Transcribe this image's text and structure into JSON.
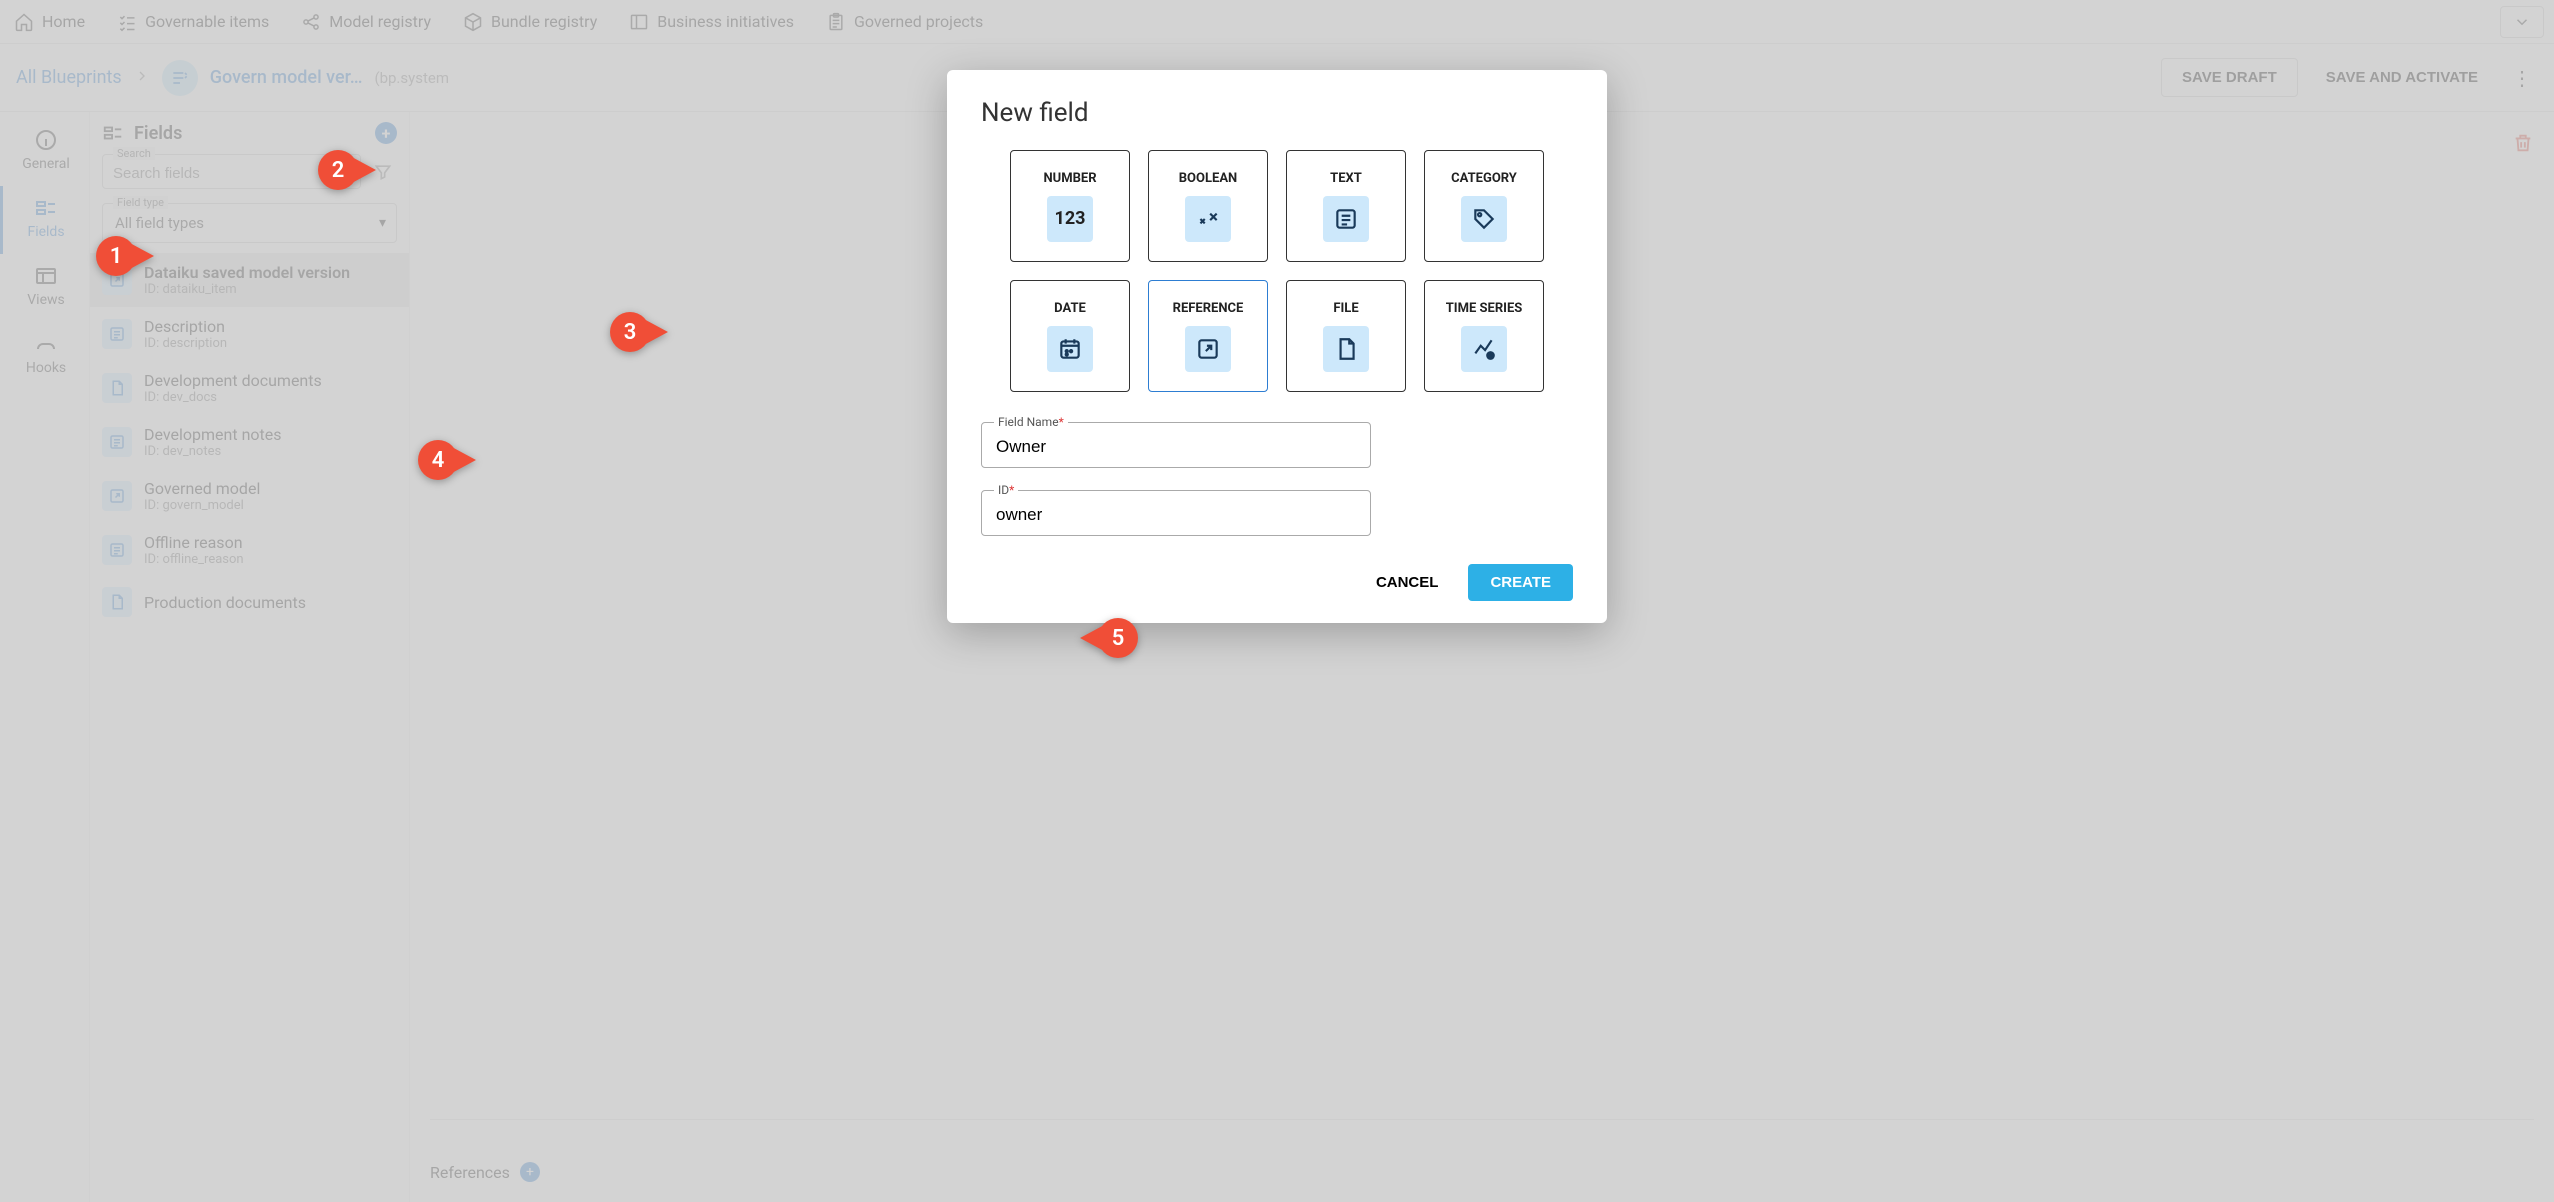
{
  "nav": {
    "items": [
      {
        "label": "Home",
        "icon": "home"
      },
      {
        "label": "Governable items",
        "icon": "list"
      },
      {
        "label": "Model registry",
        "icon": "share"
      },
      {
        "label": "Bundle registry",
        "icon": "cube"
      },
      {
        "label": "Business initiatives",
        "icon": "panel"
      },
      {
        "label": "Governed projects",
        "icon": "clipboard"
      }
    ]
  },
  "breadcrumb": {
    "root": "All Blueprints",
    "current": "Govern model ver…",
    "prefix": "(bp.system"
  },
  "actions": {
    "save_draft": "SAVE DRAFT",
    "save_activate": "SAVE AND ACTIVATE"
  },
  "side_tabs": [
    {
      "label": "General",
      "icon": "info"
    },
    {
      "label": "Fields",
      "icon": "fields",
      "active": true
    },
    {
      "label": "Views",
      "icon": "views"
    },
    {
      "label": "Hooks",
      "icon": "hooks"
    }
  ],
  "fields_panel": {
    "title": "Fields",
    "search_label": "Search",
    "search_placeholder": "Search fields",
    "type_label": "Field type",
    "type_value": "All field types",
    "items": [
      {
        "name": "Dataiku saved model version",
        "id": "ID: dataiku_item",
        "icon": "reference",
        "selected": true
      },
      {
        "name": "Description",
        "id": "ID: description",
        "icon": "text"
      },
      {
        "name": "Development documents",
        "id": "ID: dev_docs",
        "icon": "file"
      },
      {
        "name": "Development notes",
        "id": "ID: dev_notes",
        "icon": "text"
      },
      {
        "name": "Governed model",
        "id": "ID: govern_model",
        "icon": "reference"
      },
      {
        "name": "Offline reason",
        "id": "ID: offline_reason",
        "icon": "text"
      },
      {
        "name": "Production documents",
        "id": "",
        "icon": "file"
      }
    ]
  },
  "detail": {
    "references_label": "References"
  },
  "modal": {
    "title": "New field",
    "types": [
      {
        "label": "NUMBER",
        "icon": "123"
      },
      {
        "label": "BOOLEAN",
        "icon": "bool"
      },
      {
        "label": "TEXT",
        "icon": "text"
      },
      {
        "label": "CATEGORY",
        "icon": "tag"
      },
      {
        "label": "DATE",
        "icon": "date"
      },
      {
        "label": "REFERENCE",
        "icon": "ref",
        "selected": true
      },
      {
        "label": "FILE",
        "icon": "file"
      },
      {
        "label": "TIME SERIES",
        "icon": "ts"
      }
    ],
    "field_name_label": "Field Name",
    "field_name_value": "Owner",
    "id_label": "ID",
    "id_value": "owner",
    "cancel": "CANCEL",
    "create": "CREATE"
  },
  "markers": {
    "m1": "1",
    "m2": "2",
    "m3": "3",
    "m4": "4",
    "m5": "5"
  }
}
